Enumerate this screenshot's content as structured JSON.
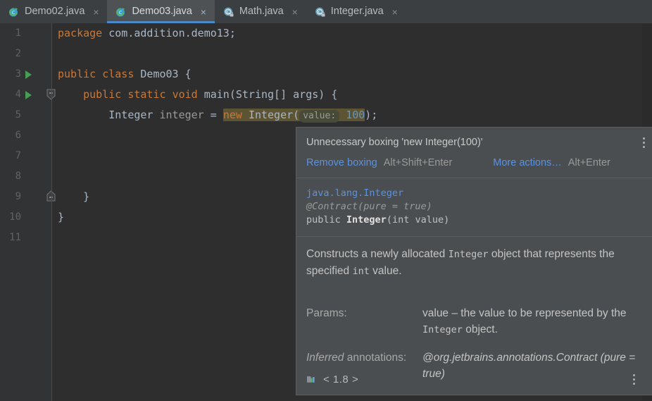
{
  "tabs": [
    {
      "label": "Demo02.java",
      "icon": "java-class-icon",
      "active": false,
      "close": "×"
    },
    {
      "label": "Demo03.java",
      "icon": "java-class-icon",
      "active": true,
      "close": "×"
    },
    {
      "label": "Math.java",
      "icon": "java-class-readonly-icon",
      "active": false,
      "close": "×"
    },
    {
      "label": "Integer.java",
      "icon": "java-class-readonly-icon",
      "active": false,
      "close": "×"
    }
  ],
  "editor": {
    "line_numbers": [
      "1",
      "2",
      "3",
      "4",
      "5",
      "6",
      "7",
      "8",
      "9",
      "10",
      "11"
    ],
    "code": {
      "l1_kw": "package",
      "l1_pkg": "com.addition.demo13;",
      "l3_kw1": "public",
      "l3_kw2": "class",
      "l3_name": "Demo03 {",
      "l4_kw1": "public",
      "l4_kw2": "static",
      "l4_kw3": "void",
      "l4_name": "main",
      "l4_params": "(String[] args) {",
      "l5_type": "Integer",
      "l5_var": "integer",
      "l5_eq": "=",
      "l5_new": "new",
      "l5_ctor": "Integer(",
      "l5_hint": "value:",
      "l5_num": "100",
      "l5_tail": ");",
      "l9_brace": "}",
      "l10_brace": "}"
    }
  },
  "popup": {
    "title": "Unnecessary boxing 'new Integer(100)'",
    "primary_action": "Remove boxing",
    "primary_shortcut": "Alt+Shift+Enter",
    "secondary_action": "More actions…",
    "secondary_shortcut": "Alt+Enter",
    "signature": {
      "fqn": "java.lang.Integer",
      "annotation": "@Contract(pure = true)",
      "modifier": "public ",
      "name": "Integer",
      "params": "(int value)"
    },
    "description": {
      "part1": "Constructs a newly allocated ",
      "code1": "Integer",
      "part2": " object that represents the specified ",
      "code2": "int",
      "part3": " value."
    },
    "params_row": {
      "key": "Params:",
      "value_part1": "value – the value to be represented by the ",
      "value_code": "Integer",
      "value_part2": " object."
    },
    "inferred_row": {
      "key_italic": "Inferred",
      "key_rest": " annotations:",
      "value": "@org.jetbrains.annotations.Contract (pure = true)"
    },
    "footer": {
      "icon": "module-library-icon",
      "text": "< 1.8 >"
    },
    "menu_icon": "kebab-menu-icon"
  },
  "colors": {
    "editor_bg": "#2e2e2e",
    "gutter_bg": "#313335",
    "tabbar_bg": "#3c3f41",
    "active_tab_bg": "#4e5254",
    "active_tab_underline": "#4a88c7",
    "popup_bg": "#4b4e50",
    "keyword": "#cc7832",
    "number": "#6897bb",
    "text": "#a9b7c6",
    "link": "#5a92e0",
    "run_marker": "#499c54",
    "highlight": "#5d5434"
  }
}
